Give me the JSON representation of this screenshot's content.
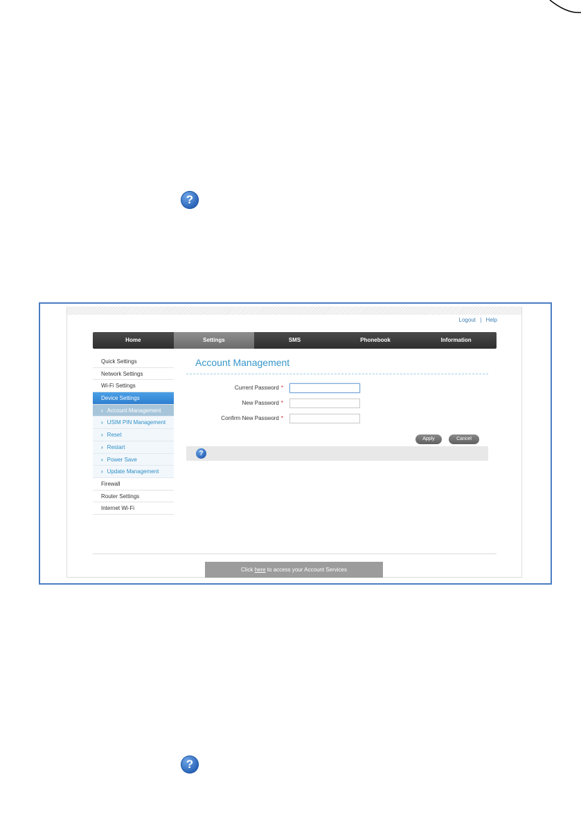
{
  "header": {
    "links": [
      "Logout",
      "Help"
    ],
    "separator": "|"
  },
  "nav": {
    "tabs": [
      "Home",
      "Settings",
      "SMS",
      "Phonebook",
      "Information"
    ],
    "active": "Settings"
  },
  "sidebar": {
    "items": [
      "Quick Settings",
      "Network Settings",
      "Wi-Fi Settings",
      "Device Settings"
    ],
    "device_settings_sub": [
      "Account Management",
      "USIM PIN Management",
      "Reset",
      "Restart",
      "Power Save",
      "Update Management"
    ],
    "items_after": [
      "Firewall",
      "Router Settings",
      "Internet Wi-Fi"
    ],
    "chevron": "›"
  },
  "main": {
    "title": "Account Management",
    "fields": [
      {
        "label": "Current Password",
        "value": "",
        "required_mark": "*"
      },
      {
        "label": "New Password",
        "value": "",
        "required_mark": "*"
      },
      {
        "label": "Confirm New Password",
        "value": "",
        "required_mark": "*"
      }
    ],
    "apply_label": "Apply",
    "cancel_label": "Cancel",
    "help_glyph": "?"
  },
  "footer": {
    "prefix": "Click ",
    "link": "here",
    "suffix": " to access your Account Services"
  },
  "document": {
    "help_glyph": "?"
  },
  "colors": {
    "accent": "#3896c9",
    "frame_border": "#4a7cc2",
    "nav_bg": "#333333",
    "sidebar_active": "#2f7fd0"
  }
}
